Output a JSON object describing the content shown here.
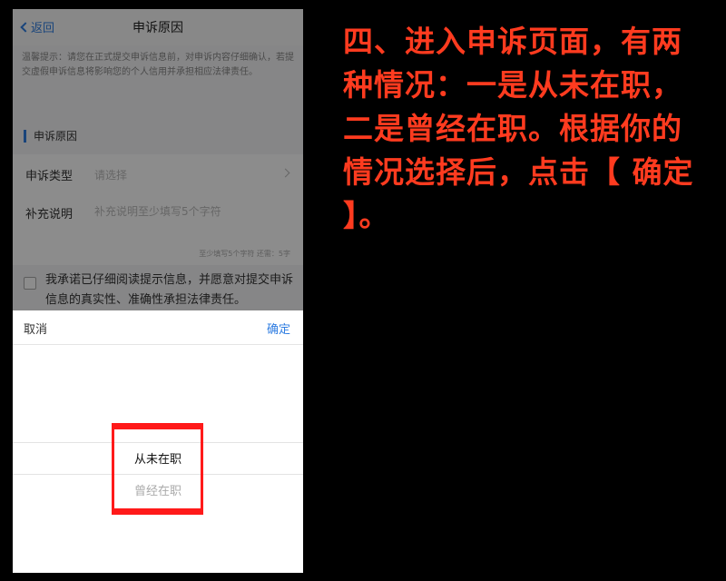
{
  "nav": {
    "back_label": "返回",
    "title": "申诉原因"
  },
  "notice": "温馨提示：请您在正式提交申诉信息前，对申诉内容仔细确认，若提交虚假申诉信息将影响您的个人信用并承担相应法律责任。",
  "section": {
    "title": "申诉原因"
  },
  "form": {
    "type_label": "申诉类型",
    "type_placeholder": "请选择",
    "note_label": "补充说明",
    "note_placeholder": "补充说明至少填写5个字符",
    "char_count": "至少填写5个字符 还需：5字"
  },
  "agreement": "我承诺已仔细阅读提示信息，并愿意对提交申诉信息的真实性、准确性承担法律责任。",
  "picker": {
    "cancel_label": "取消",
    "confirm_label": "确定",
    "options": [
      "从未在职",
      "曾经在职"
    ],
    "selected": "从未在职"
  },
  "instruction": "四、进入申诉页面，有两种情况：一是从未在职，二是曾经在职。根据你的情况选择后，点击【 确定 】。",
  "colors": {
    "accent": "#2f7de1",
    "highlight": "#ff1a1a",
    "instruction_text": "#ff3b1f"
  }
}
